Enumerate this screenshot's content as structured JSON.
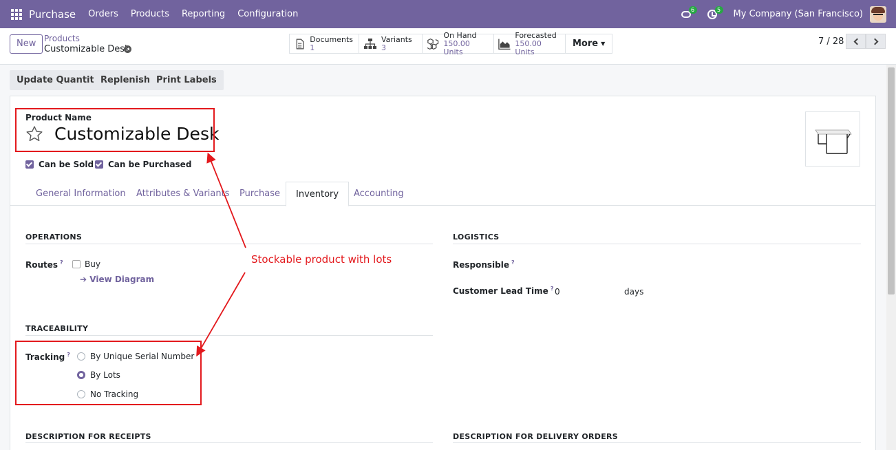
{
  "navbar": {
    "brand": "Purchase",
    "menu": [
      "Orders",
      "Products",
      "Reporting",
      "Configuration"
    ],
    "messages_badge": "6",
    "activities_badge": "5",
    "company": "My Company (San Francisco)"
  },
  "control": {
    "new_label": "New",
    "breadcrumb_parent": "Products",
    "breadcrumb_current": "Customizable Desk",
    "smart_buttons": [
      {
        "label": "Documents",
        "value": "1",
        "icon": "document-icon"
      },
      {
        "label": "Variants",
        "value": "3",
        "icon": "sitemap-icon"
      },
      {
        "label": "On Hand",
        "value": "150.00 Units",
        "icon": "cubes-icon"
      },
      {
        "label": "Forecasted",
        "value": "150.00 Units",
        "icon": "area-chart-icon"
      }
    ],
    "more_label": "More",
    "pager": "7 / 28"
  },
  "actions": [
    "Update Quantity",
    "Replenish",
    "Print Labels"
  ],
  "form": {
    "product_name_label": "Product Name",
    "product_name": "Customizable Desk",
    "can_be_sold": "Can be Sold",
    "can_be_purchased": "Can be Purchased",
    "tabs": [
      "General Information",
      "Attributes & Variants",
      "Purchase",
      "Inventory",
      "Accounting"
    ],
    "active_tab": "Inventory",
    "operations_title": "OPERATIONS",
    "routes_label": "Routes",
    "route_buy": "Buy",
    "view_diagram": "View Diagram",
    "logistics_title": "LOGISTICS",
    "responsible_label": "Responsible",
    "lead_time_label": "Customer Lead Time",
    "lead_time_value": "0",
    "lead_time_unit": "days",
    "traceability_title": "TRACEABILITY",
    "tracking_label": "Tracking",
    "tracking_options": [
      "By Unique Serial Number",
      "By Lots",
      "No Tracking"
    ],
    "tracking_selected": "By Lots",
    "desc_receipts_title": "DESCRIPTION FOR RECEIPTS",
    "desc_delivery_title": "DESCRIPTION FOR DELIVERY ORDERS",
    "help_mark": "?"
  },
  "annotation": {
    "text": "Stockable product with lots",
    "color": "#e3191d"
  },
  "colors": {
    "navbar": "#71639e",
    "accent": "#71639e",
    "badge": "#28a745"
  }
}
